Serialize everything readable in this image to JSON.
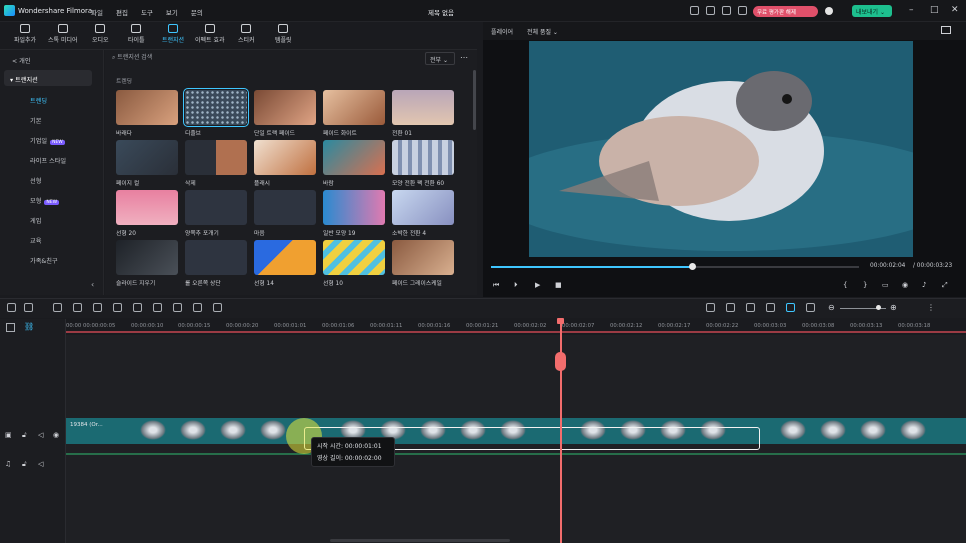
{
  "app": {
    "title": "Wondershare Filmora",
    "project_title": "제목 없음",
    "promo": "무료 평가판 해제",
    "export": "내보내기 ⌄"
  },
  "menu": [
    "파일",
    "편집",
    "도구",
    "보기",
    "문의"
  ],
  "toolbar": [
    "파일추가",
    "스톡 미디어",
    "오디오",
    "타이틀",
    "트랜지션",
    "이펙트 효과",
    "스티커",
    "템플릿"
  ],
  "sidebar": {
    "back": "< 개인",
    "head": "▾ 트랜지션",
    "items": [
      "트렌딩",
      "기본",
      "기업일",
      "라이프 스타일",
      "선형",
      "모형",
      "게임",
      "교육",
      "가족&친구"
    ],
    "new_badge": "NEW"
  },
  "browser": {
    "search_placeholder": "트랜지션 검색",
    "filter": "전부 ⌄",
    "section": "트렌딩",
    "cards": [
      "바래다",
      "디졸브",
      "단일 트랙 페이드",
      "페이드 화이트",
      "전환 01",
      "페이지 컬",
      "삭제",
      "플래시",
      "바람",
      "모양 전환 팩 전환 60",
      "선형 20",
      "양쪽추 포개기",
      "마음",
      "일반 모양 19",
      "소박한 전환 4",
      "슬라이드 지우기",
      "롤 오른쪽 상단",
      "선형 14",
      "선형 10",
      "페이드 그레이스케일"
    ]
  },
  "player": {
    "label": "플레이어",
    "quality": "전체 품질 ⌄",
    "current": "00:00:02:04",
    "total": "/ 00:00:03:23",
    "progress": 0.55
  },
  "ruler": [
    "00:00",
    "00:00:00:05",
    "00:00:00:10",
    "00:00:00:15",
    "00:00:00:20",
    "00:00:01:01",
    "00:00:01:06",
    "00:00:01:11",
    "00:00:01:16",
    "00:00:01:21",
    "00:00:02:02",
    "00:00:02:07",
    "00:00:02:12",
    "00:00:02:17",
    "00:00:02:22",
    "00:00:03:03",
    "00:00:03:08",
    "00:00:03:13",
    "00:00:03:18"
  ],
  "clip": {
    "name": "19384 (Or...",
    "tooltip_start": "시작 시간: 00:00:01:01",
    "tooltip_duration": "영상 길이: 00:00:02:00"
  },
  "colors": {
    "accent": "#3fc6ff",
    "playhead": "#f26d6d",
    "export": "#1dbf8e"
  }
}
